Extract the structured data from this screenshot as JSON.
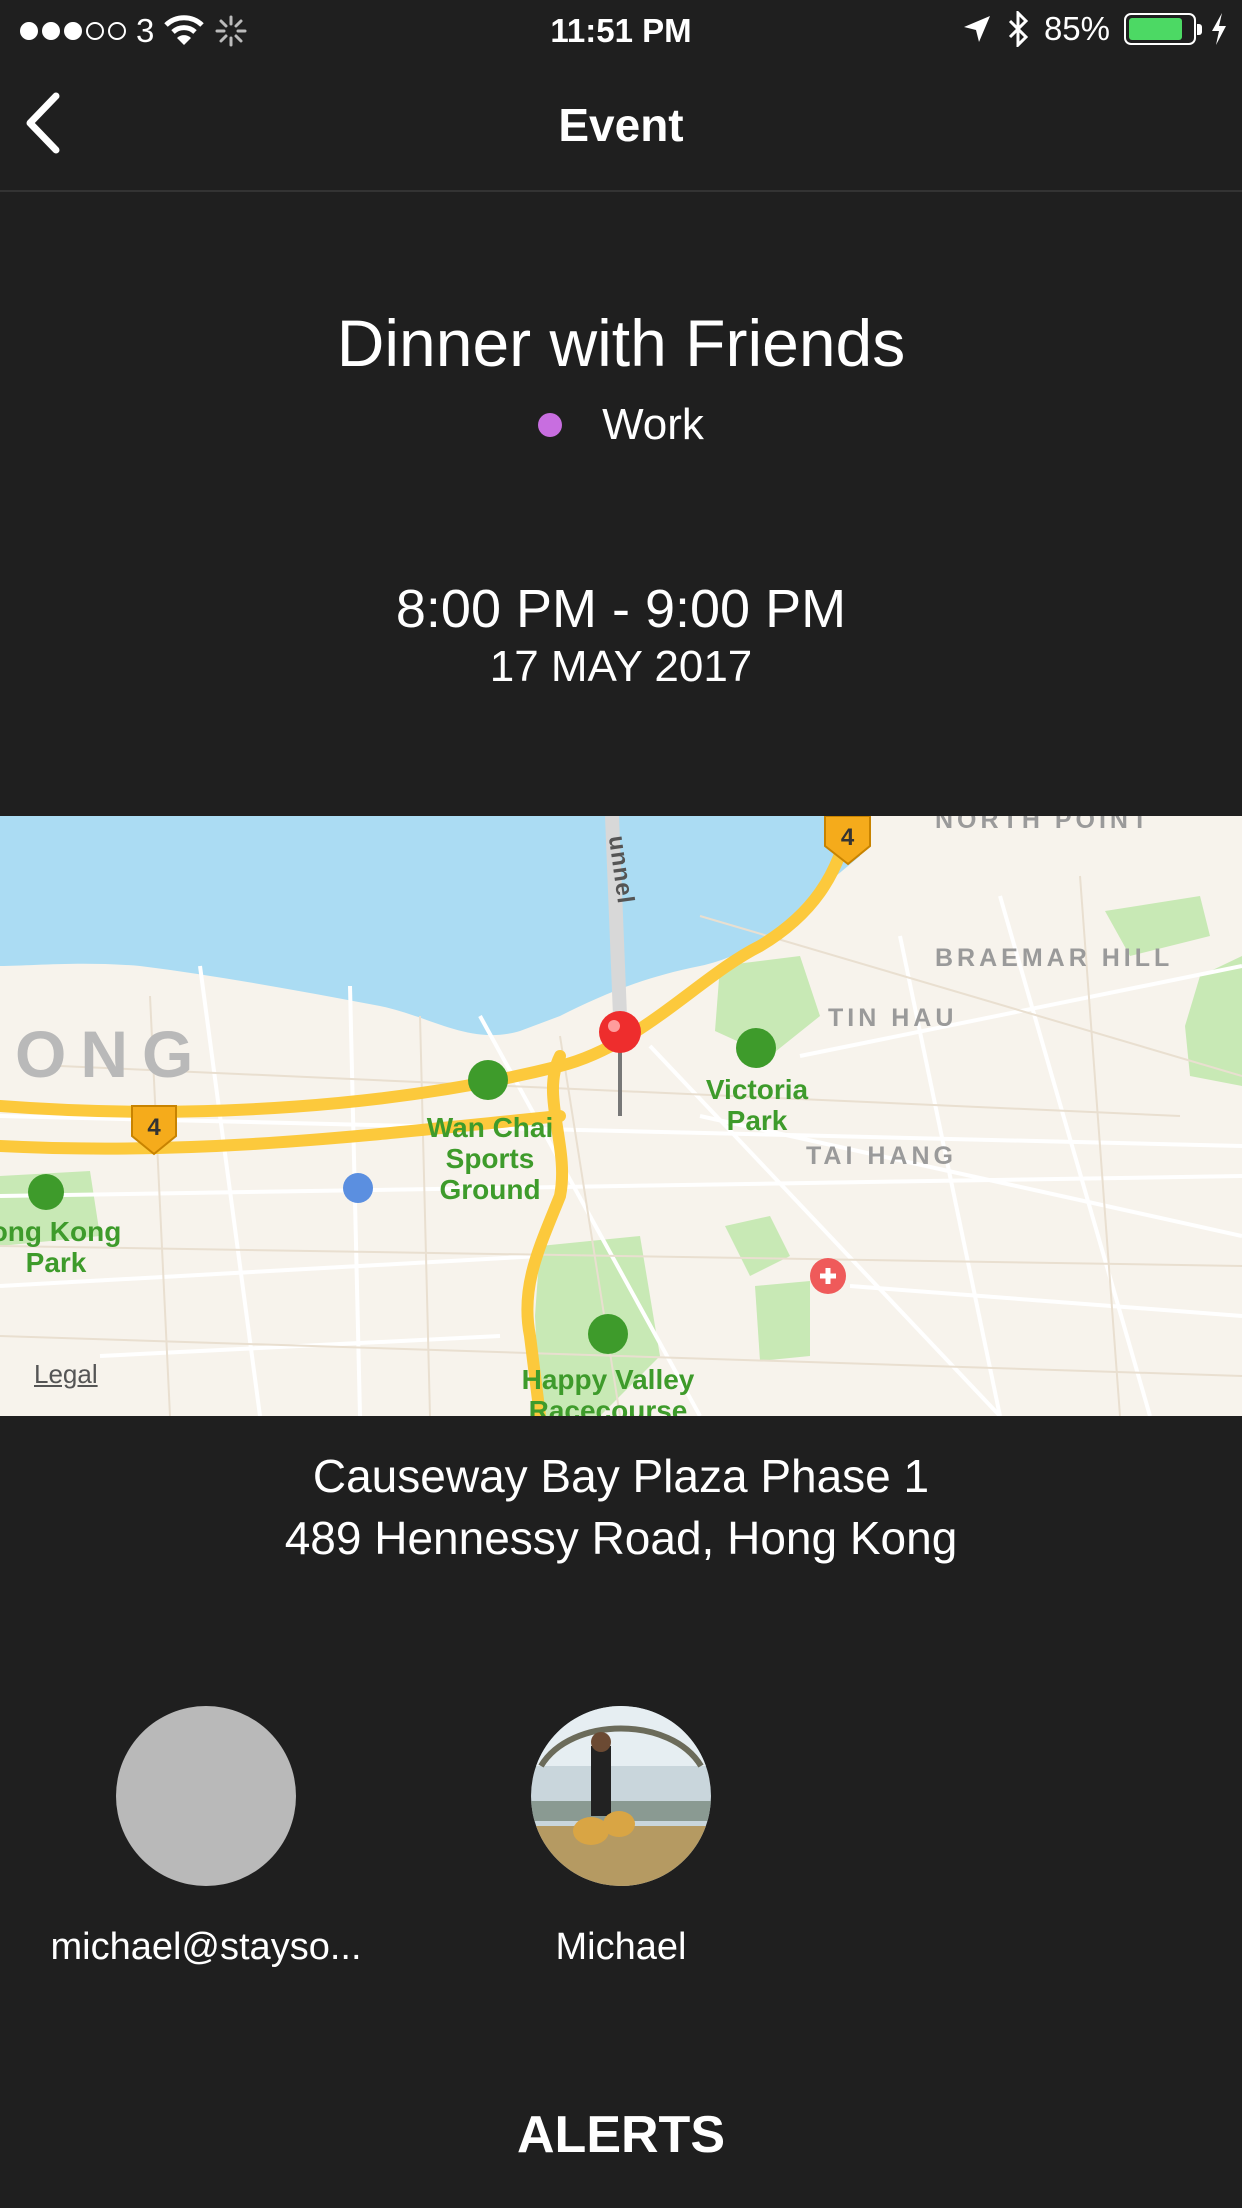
{
  "status_bar": {
    "carrier": "3",
    "time": "11:51 PM",
    "battery": "85%",
    "battery_level": 0.85,
    "icons": [
      "signal-dots-icon",
      "wifi-icon",
      "activity-spinner-icon",
      "location-arrow-icon",
      "bluetooth-icon",
      "battery-icon",
      "charging-bolt-icon"
    ]
  },
  "nav": {
    "title": "Event",
    "back_icon": "chevron-left-icon"
  },
  "event": {
    "title": "Dinner with Friends",
    "calendar": "Work",
    "calendar_color": "#c86ee0",
    "time_range": "8:00 PM - 9:00 PM",
    "date": "17 MAY 2017"
  },
  "map": {
    "labels": {
      "district_braemar": "BRAEMAR HILL",
      "district_tinhau": "TIN HAU",
      "district_taihang": "TAI HANG",
      "district_northpoint": "NORTH POINT",
      "district_ong": "ONG",
      "tunnel": "unnel",
      "wanchai": "Wan Chai\nSports\nGround",
      "victoria": "Victoria\nPark",
      "happyvalley": "Happy Valley\nRacecourse",
      "hkpark": "ong Kong\nPark",
      "route_badge": "4",
      "legal": "Legal"
    },
    "colors": {
      "water": "#abdcf3",
      "land": "#f7f3ec",
      "park": "#c8e9b5",
      "road_major": "#fcc93c",
      "pin": "#ee2d2d"
    }
  },
  "address": {
    "line1": "Causeway Bay Plaza Phase 1",
    "line2": "489 Hennessy Road, Hong Kong"
  },
  "attendees": [
    {
      "name": "michael@stayso...",
      "avatar": "blank"
    },
    {
      "name": "Michael",
      "avatar": "photo"
    }
  ],
  "alerts_heading": "ALERTS"
}
